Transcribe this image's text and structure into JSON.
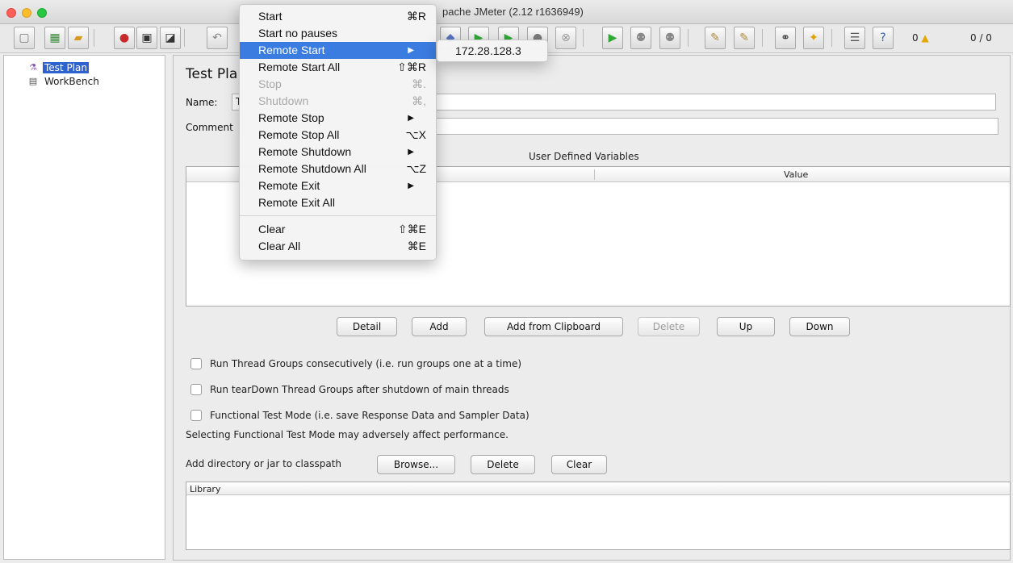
{
  "window": {
    "title": "Apache JMeter (2.12 r1636949)",
    "title_visible": "pache JMeter (2.12 r1636949)"
  },
  "toolbar": {
    "warning_count": "0",
    "threads_counter": "0 / 0"
  },
  "tree": {
    "items": [
      {
        "label": "Test Plan",
        "icon": "test-plan-flask-icon",
        "selected": true
      },
      {
        "label": "WorkBench",
        "icon": "workbench-clipboard-icon",
        "selected": false
      }
    ]
  },
  "main": {
    "title": "Test Pla",
    "name_label": "Name:",
    "name_value": "T",
    "comments_label": "Comment",
    "udv_title": "User Defined Variables",
    "table_columns": [
      "Value"
    ],
    "buttons": {
      "detail": "Detail",
      "add": "Add",
      "add_clipboard": "Add from Clipboard",
      "delete": "Delete",
      "up": "Up",
      "down": "Down"
    },
    "checkboxes": [
      "Run Thread Groups consecutively (i.e. run groups one at a time)",
      "Run tearDown Thread Groups after shutdown of main threads",
      "Functional Test Mode (i.e. save Response Data and Sampler Data)"
    ],
    "functional_note": "Selecting Functional Test Mode may adversely affect performance.",
    "classpath_label": "Add directory or jar to classpath",
    "classpath_buttons": {
      "browse": "Browse...",
      "delete": "Delete",
      "clear": "Clear"
    },
    "library_header": "Library"
  },
  "menu": {
    "items": [
      {
        "label": "Start",
        "shortcut": "⌘R"
      },
      {
        "label": "Start no pauses",
        "shortcut": ""
      },
      {
        "label": "Remote Start",
        "shortcut": "",
        "submenu": true,
        "highlighted": true
      },
      {
        "label": "Remote Start All",
        "shortcut": "⇧⌘R"
      },
      {
        "label": "Stop",
        "shortcut": "⌘.",
        "disabled": true
      },
      {
        "label": "Shutdown",
        "shortcut": "⌘,",
        "disabled": true
      },
      {
        "label": "Remote Stop",
        "shortcut": "",
        "submenu": true
      },
      {
        "label": "Remote Stop All",
        "shortcut": "⌥X"
      },
      {
        "label": "Remote Shutdown",
        "shortcut": "",
        "submenu": true
      },
      {
        "label": "Remote Shutdown All",
        "shortcut": "⌥Z"
      },
      {
        "label": "Remote Exit",
        "shortcut": "",
        "submenu": true
      },
      {
        "label": "Remote Exit All",
        "shortcut": ""
      },
      {
        "label": "Clear",
        "shortcut": "⇧⌘E"
      },
      {
        "label": "Clear All",
        "shortcut": "⌘E"
      }
    ],
    "submenu_item": "172.28.128.3"
  },
  "colors": {
    "selection": "#2e62cf",
    "menu_highlight": "#3b7ce0"
  }
}
